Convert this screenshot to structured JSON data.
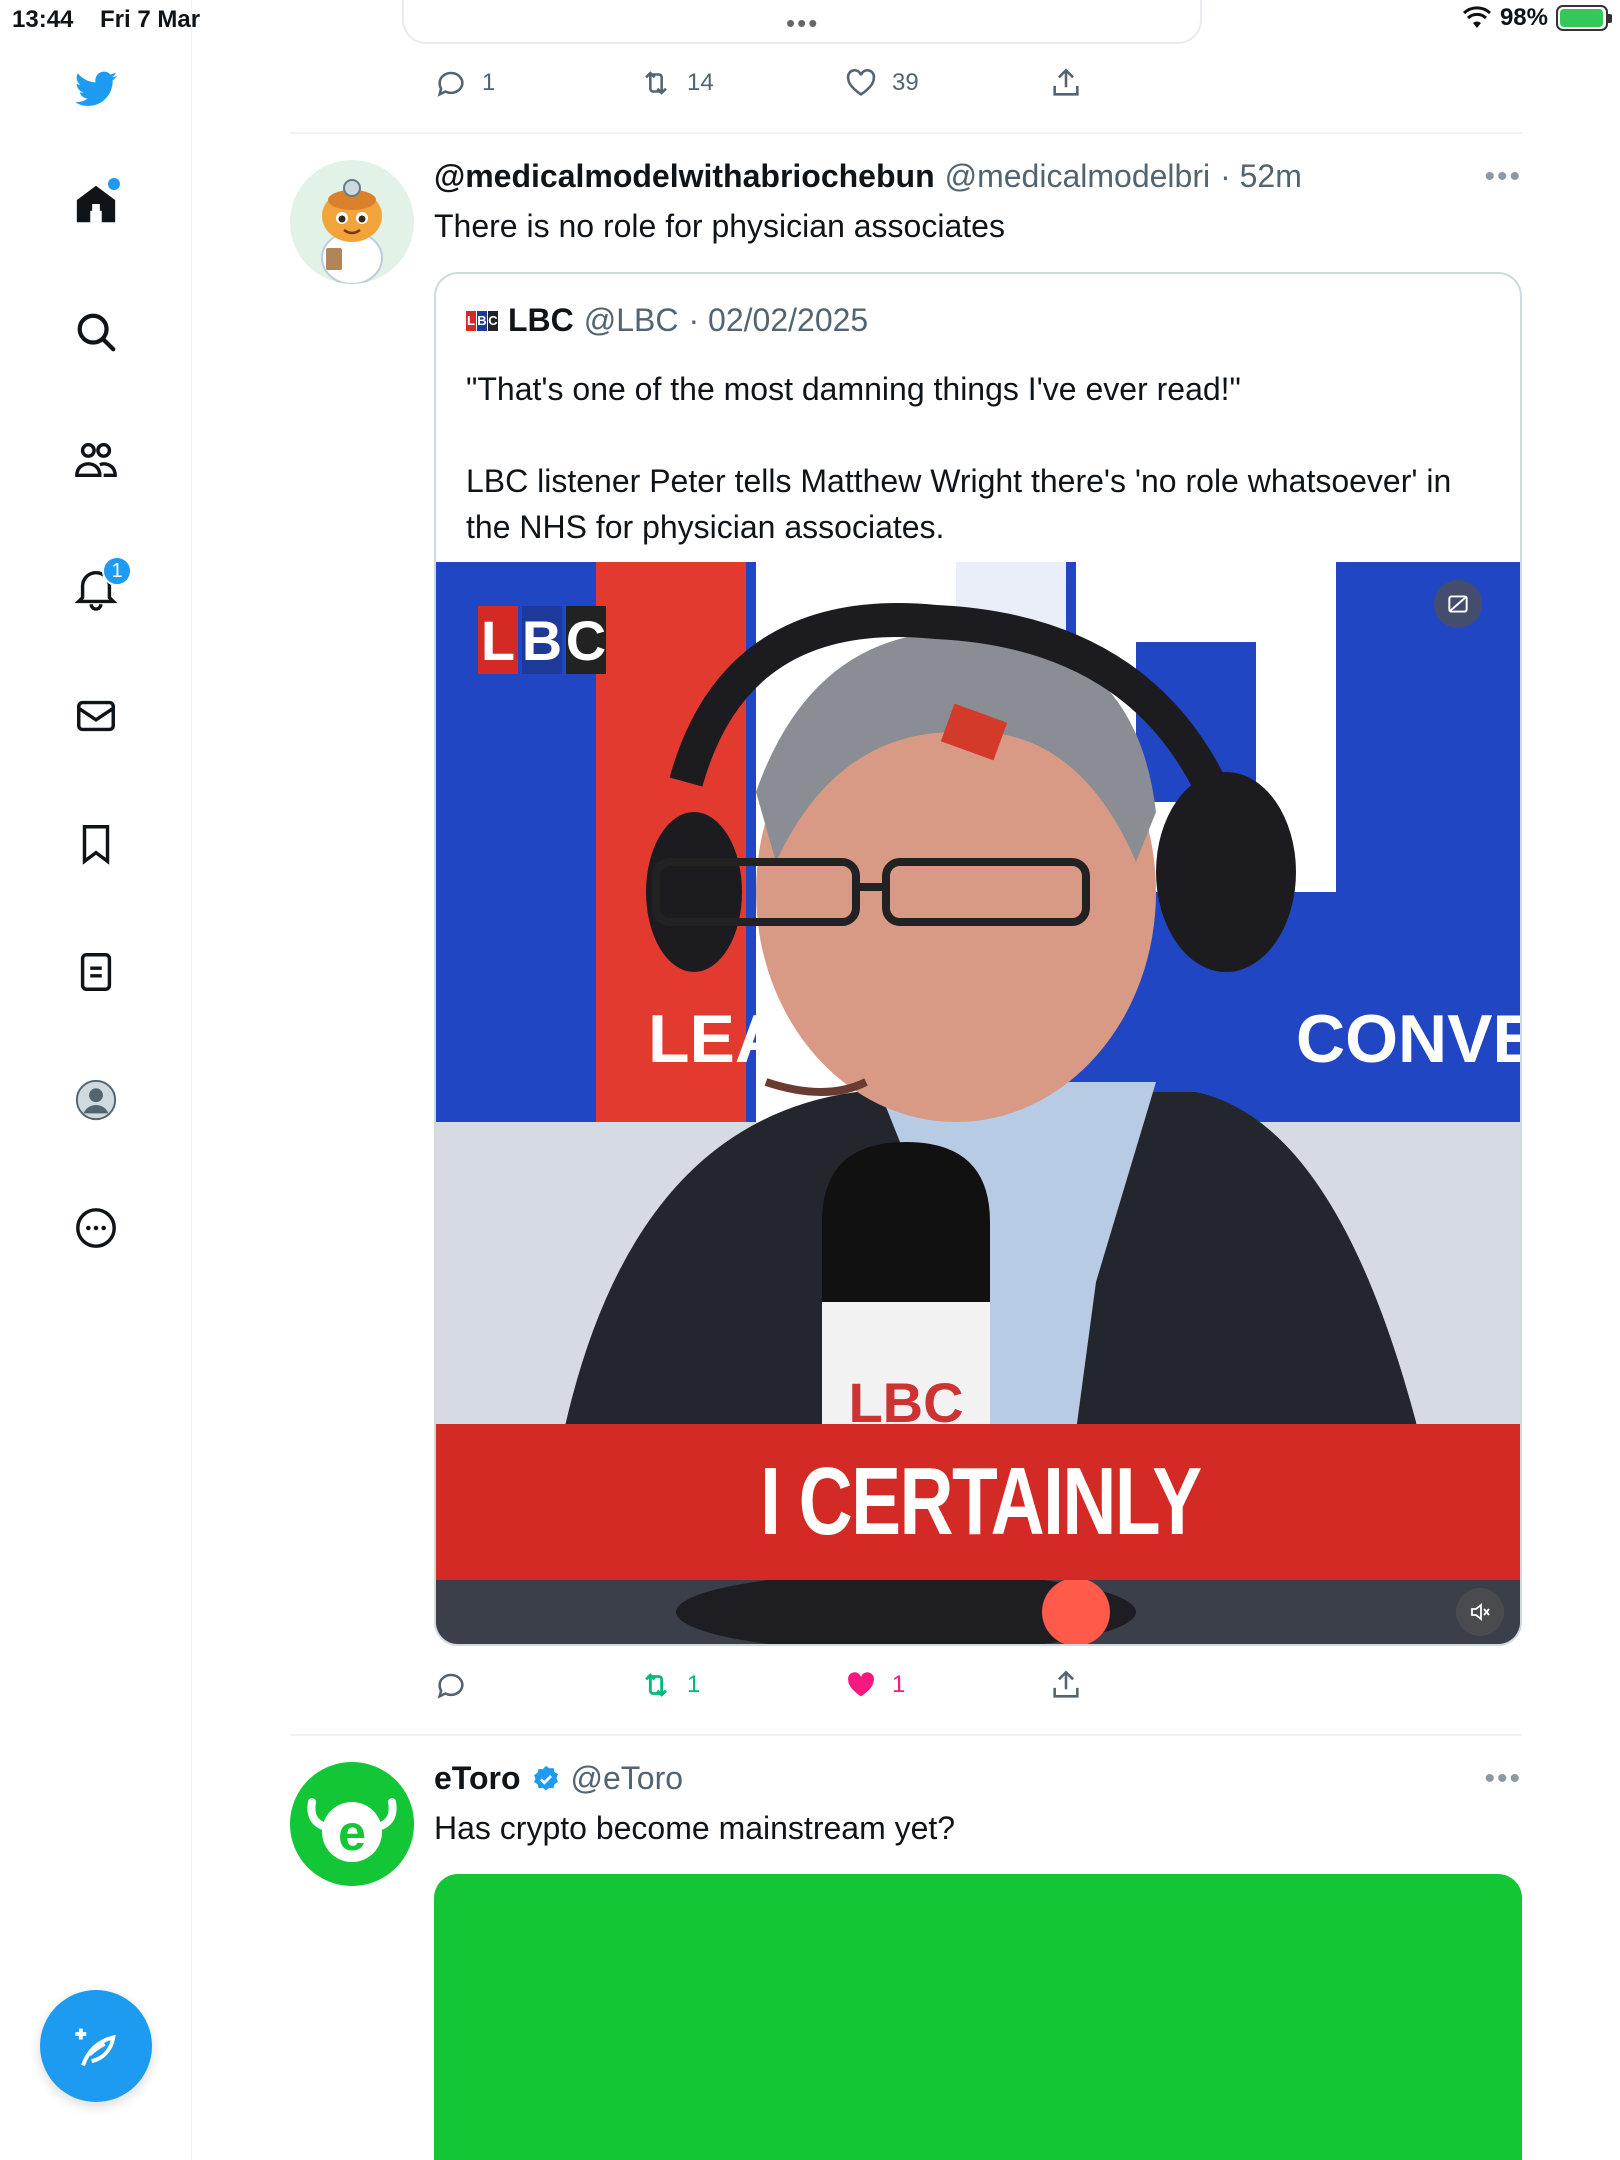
{
  "status_bar": {
    "time": "13:44",
    "date": "Fri 7 Mar",
    "battery": "98%",
    "battery_level": 0.98
  },
  "sidebar": {
    "notifications_badge": "1",
    "items": [
      "home",
      "explore",
      "communities",
      "notifications",
      "messages",
      "bookmarks",
      "lists",
      "profile",
      "more"
    ]
  },
  "prev_tweet": {
    "replies": "1",
    "retweets": "14",
    "likes": "39"
  },
  "tweet1": {
    "display_name": "@medicalmodelwithabriochebun",
    "handle": "@medicalmodelbri",
    "time": "· 52m",
    "text": "There is no role for physician associates",
    "quote": {
      "name": "LBC",
      "handle": "@LBC",
      "date": "· 02/02/2025",
      "line1": "\"That's one of the most damning things I've ever read!\"",
      "line2": "LBC listener Peter tells Matthew Wright there's 'no role whatsoever' in the NHS for physician associates.",
      "video_caption": "I CERTAINLY",
      "logo_letters": [
        "L",
        "B",
        "C"
      ],
      "mic_logo": "LBC",
      "backdrop_text_left": "LEA",
      "backdrop_text_right": "CONVERS"
    },
    "replies": "",
    "retweets": "1",
    "likes": "1"
  },
  "tweet2": {
    "display_name": "eToro",
    "handle": "@eToro",
    "text": "Has crypto become mainstream yet?",
    "avatar_letter": "e"
  },
  "colors": {
    "accent": "#1d9bf0",
    "lbc_red": "#d42a25",
    "lbc_blue": "#1d3a9a",
    "retweet_green": "#00ba7c",
    "like_pink": "#f91880",
    "etoro_green": "#13c636"
  }
}
